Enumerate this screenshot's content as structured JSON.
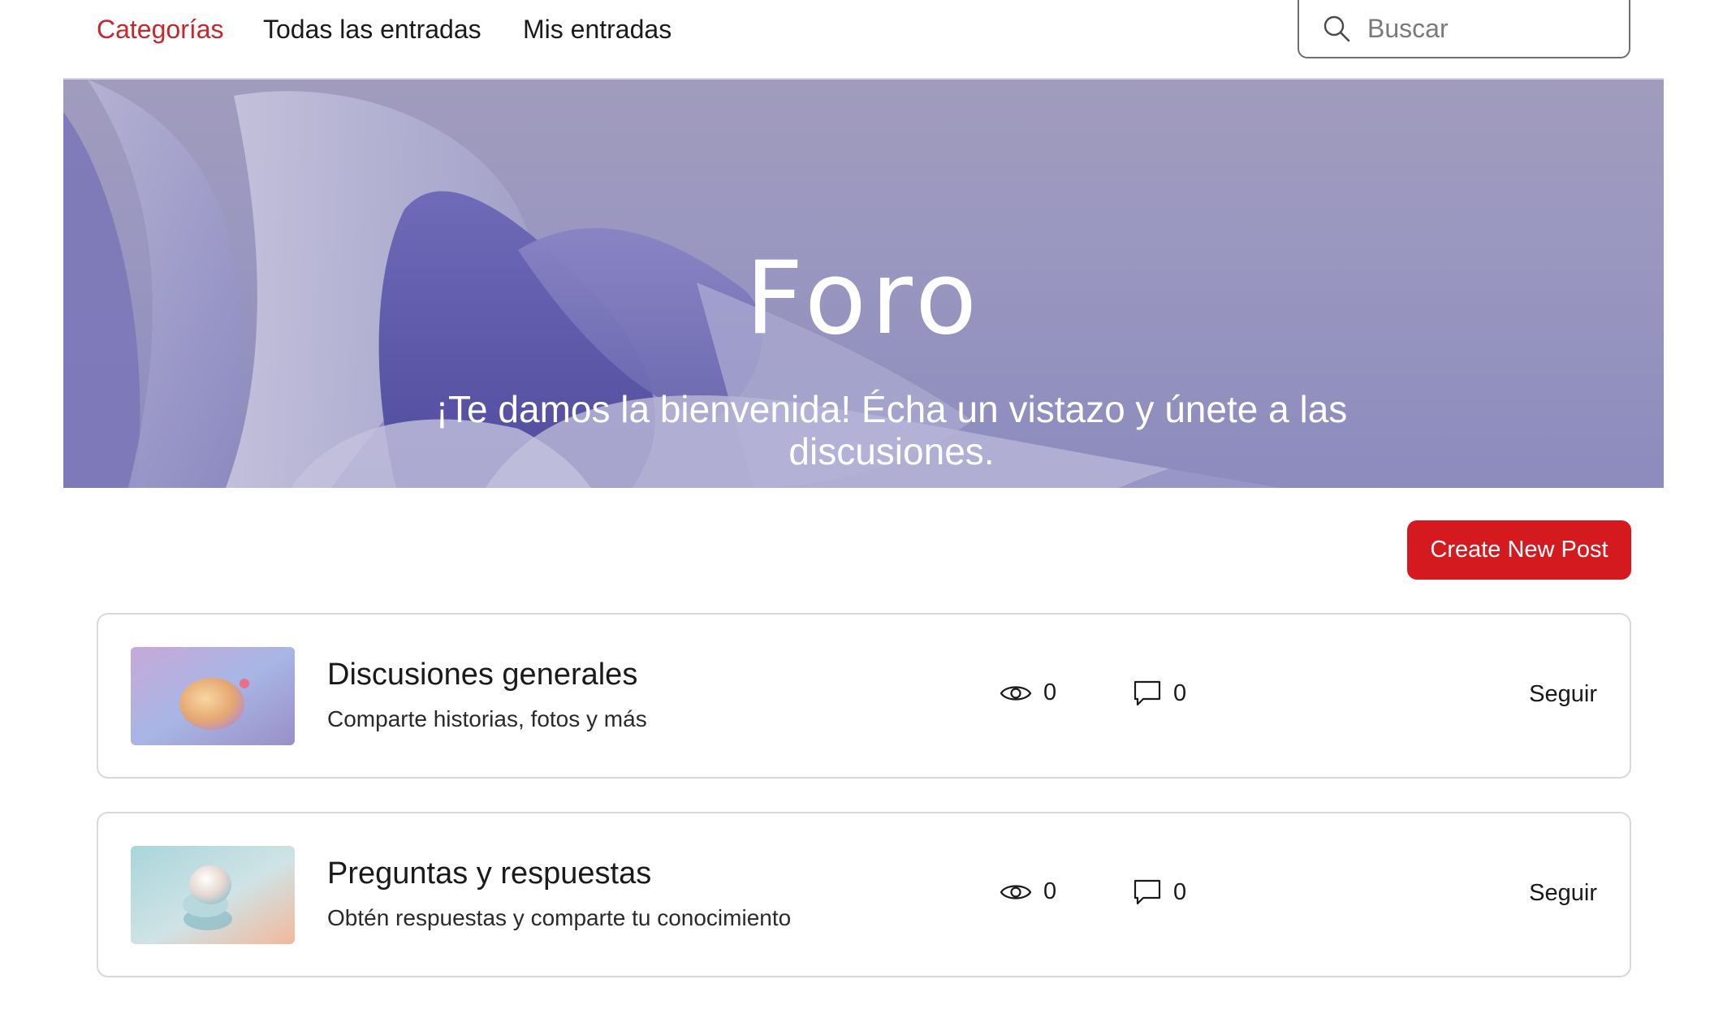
{
  "nav": {
    "items": [
      {
        "label": "Categorías",
        "active": true
      },
      {
        "label": "Todas las entradas",
        "active": false
      },
      {
        "label": "Mis entradas",
        "active": false
      }
    ],
    "search": {
      "placeholder": "Buscar",
      "value": ""
    }
  },
  "hero": {
    "title": "Foro",
    "subtitle": "¡Te damos la bienvenida! Écha un vistazo y únete a las discusiones."
  },
  "actions": {
    "create_label": "Create New Post"
  },
  "categories": [
    {
      "title": "Discusiones generales",
      "description": "Comparte historias, fotos y más",
      "views": "0",
      "comments": "0",
      "follow_label": "Seguir"
    },
    {
      "title": "Preguntas y respuestas",
      "description": "Obtén respuestas y comparte tu conocimiento",
      "views": "0",
      "comments": "0",
      "follow_label": "Seguir"
    }
  ],
  "colors": {
    "accent": "#c8262b",
    "button": "#d51a1f",
    "hero": "#9996c0"
  }
}
